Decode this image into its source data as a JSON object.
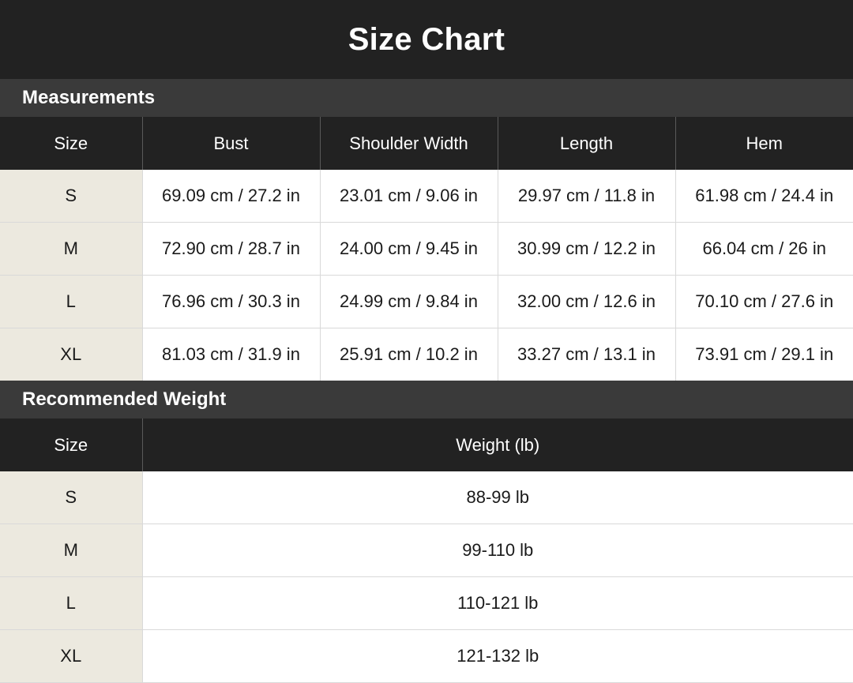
{
  "title": "Size Chart",
  "measurements": {
    "section_title": "Measurements",
    "headers": [
      "Size",
      "Bust",
      "Shoulder Width",
      "Length",
      "Hem"
    ],
    "rows": [
      [
        "S",
        "69.09 cm / 27.2 in",
        "23.01 cm / 9.06 in",
        "29.97 cm / 11.8 in",
        "61.98 cm / 24.4 in"
      ],
      [
        "M",
        "72.90 cm / 28.7 in",
        "24.00 cm / 9.45 in",
        "30.99 cm / 12.2 in",
        "66.04 cm / 26 in"
      ],
      [
        "L",
        "76.96 cm / 30.3 in",
        "24.99 cm / 9.84 in",
        "32.00 cm / 12.6 in",
        "70.10 cm / 27.6 in"
      ],
      [
        "XL",
        "81.03 cm / 31.9 in",
        "25.91 cm / 10.2 in",
        "33.27 cm / 13.1 in",
        "73.91 cm / 29.1 in"
      ]
    ]
  },
  "weight": {
    "section_title": "Recommended Weight",
    "headers": [
      "Size",
      "Weight (lb)"
    ],
    "rows": [
      [
        "S",
        "88-99 lb"
      ],
      [
        "M",
        "99-110 lb"
      ],
      [
        "L",
        "110-121 lb"
      ],
      [
        "XL",
        "121-132 lb"
      ]
    ]
  },
  "colors": {
    "header_dark": "#222222",
    "section_bar": "#3a3a3a",
    "size_column": "#ece9df"
  }
}
